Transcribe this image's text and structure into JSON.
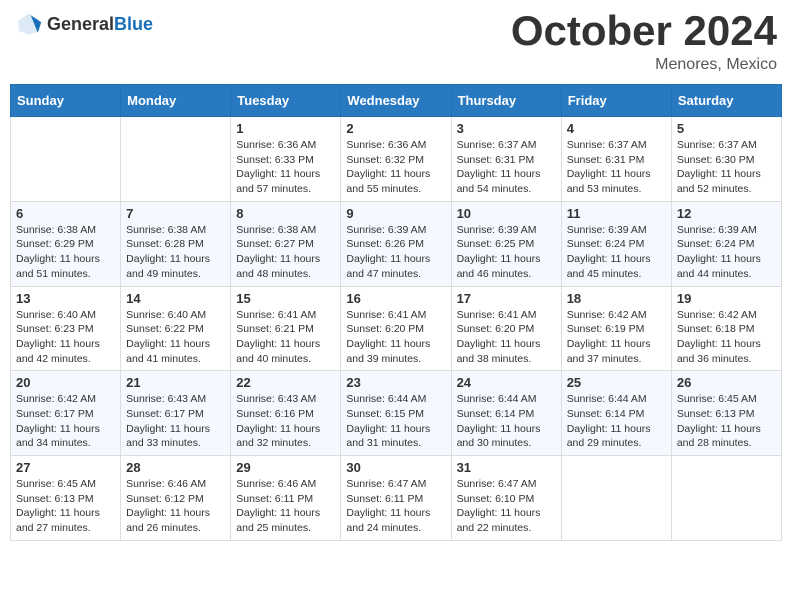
{
  "logo": {
    "general": "General",
    "blue": "Blue"
  },
  "header": {
    "month": "October 2024",
    "location": "Menores, Mexico"
  },
  "weekdays": [
    "Sunday",
    "Monday",
    "Tuesday",
    "Wednesday",
    "Thursday",
    "Friday",
    "Saturday"
  ],
  "weeks": [
    [
      {
        "day": "",
        "sunrise": "",
        "sunset": "",
        "daylight": ""
      },
      {
        "day": "",
        "sunrise": "",
        "sunset": "",
        "daylight": ""
      },
      {
        "day": "1",
        "sunrise": "Sunrise: 6:36 AM",
        "sunset": "Sunset: 6:33 PM",
        "daylight": "Daylight: 11 hours and 57 minutes."
      },
      {
        "day": "2",
        "sunrise": "Sunrise: 6:36 AM",
        "sunset": "Sunset: 6:32 PM",
        "daylight": "Daylight: 11 hours and 55 minutes."
      },
      {
        "day": "3",
        "sunrise": "Sunrise: 6:37 AM",
        "sunset": "Sunset: 6:31 PM",
        "daylight": "Daylight: 11 hours and 54 minutes."
      },
      {
        "day": "4",
        "sunrise": "Sunrise: 6:37 AM",
        "sunset": "Sunset: 6:31 PM",
        "daylight": "Daylight: 11 hours and 53 minutes."
      },
      {
        "day": "5",
        "sunrise": "Sunrise: 6:37 AM",
        "sunset": "Sunset: 6:30 PM",
        "daylight": "Daylight: 11 hours and 52 minutes."
      }
    ],
    [
      {
        "day": "6",
        "sunrise": "Sunrise: 6:38 AM",
        "sunset": "Sunset: 6:29 PM",
        "daylight": "Daylight: 11 hours and 51 minutes."
      },
      {
        "day": "7",
        "sunrise": "Sunrise: 6:38 AM",
        "sunset": "Sunset: 6:28 PM",
        "daylight": "Daylight: 11 hours and 49 minutes."
      },
      {
        "day": "8",
        "sunrise": "Sunrise: 6:38 AM",
        "sunset": "Sunset: 6:27 PM",
        "daylight": "Daylight: 11 hours and 48 minutes."
      },
      {
        "day": "9",
        "sunrise": "Sunrise: 6:39 AM",
        "sunset": "Sunset: 6:26 PM",
        "daylight": "Daylight: 11 hours and 47 minutes."
      },
      {
        "day": "10",
        "sunrise": "Sunrise: 6:39 AM",
        "sunset": "Sunset: 6:25 PM",
        "daylight": "Daylight: 11 hours and 46 minutes."
      },
      {
        "day": "11",
        "sunrise": "Sunrise: 6:39 AM",
        "sunset": "Sunset: 6:24 PM",
        "daylight": "Daylight: 11 hours and 45 minutes."
      },
      {
        "day": "12",
        "sunrise": "Sunrise: 6:39 AM",
        "sunset": "Sunset: 6:24 PM",
        "daylight": "Daylight: 11 hours and 44 minutes."
      }
    ],
    [
      {
        "day": "13",
        "sunrise": "Sunrise: 6:40 AM",
        "sunset": "Sunset: 6:23 PM",
        "daylight": "Daylight: 11 hours and 42 minutes."
      },
      {
        "day": "14",
        "sunrise": "Sunrise: 6:40 AM",
        "sunset": "Sunset: 6:22 PM",
        "daylight": "Daylight: 11 hours and 41 minutes."
      },
      {
        "day": "15",
        "sunrise": "Sunrise: 6:41 AM",
        "sunset": "Sunset: 6:21 PM",
        "daylight": "Daylight: 11 hours and 40 minutes."
      },
      {
        "day": "16",
        "sunrise": "Sunrise: 6:41 AM",
        "sunset": "Sunset: 6:20 PM",
        "daylight": "Daylight: 11 hours and 39 minutes."
      },
      {
        "day": "17",
        "sunrise": "Sunrise: 6:41 AM",
        "sunset": "Sunset: 6:20 PM",
        "daylight": "Daylight: 11 hours and 38 minutes."
      },
      {
        "day": "18",
        "sunrise": "Sunrise: 6:42 AM",
        "sunset": "Sunset: 6:19 PM",
        "daylight": "Daylight: 11 hours and 37 minutes."
      },
      {
        "day": "19",
        "sunrise": "Sunrise: 6:42 AM",
        "sunset": "Sunset: 6:18 PM",
        "daylight": "Daylight: 11 hours and 36 minutes."
      }
    ],
    [
      {
        "day": "20",
        "sunrise": "Sunrise: 6:42 AM",
        "sunset": "Sunset: 6:17 PM",
        "daylight": "Daylight: 11 hours and 34 minutes."
      },
      {
        "day": "21",
        "sunrise": "Sunrise: 6:43 AM",
        "sunset": "Sunset: 6:17 PM",
        "daylight": "Daylight: 11 hours and 33 minutes."
      },
      {
        "day": "22",
        "sunrise": "Sunrise: 6:43 AM",
        "sunset": "Sunset: 6:16 PM",
        "daylight": "Daylight: 11 hours and 32 minutes."
      },
      {
        "day": "23",
        "sunrise": "Sunrise: 6:44 AM",
        "sunset": "Sunset: 6:15 PM",
        "daylight": "Daylight: 11 hours and 31 minutes."
      },
      {
        "day": "24",
        "sunrise": "Sunrise: 6:44 AM",
        "sunset": "Sunset: 6:14 PM",
        "daylight": "Daylight: 11 hours and 30 minutes."
      },
      {
        "day": "25",
        "sunrise": "Sunrise: 6:44 AM",
        "sunset": "Sunset: 6:14 PM",
        "daylight": "Daylight: 11 hours and 29 minutes."
      },
      {
        "day": "26",
        "sunrise": "Sunrise: 6:45 AM",
        "sunset": "Sunset: 6:13 PM",
        "daylight": "Daylight: 11 hours and 28 minutes."
      }
    ],
    [
      {
        "day": "27",
        "sunrise": "Sunrise: 6:45 AM",
        "sunset": "Sunset: 6:13 PM",
        "daylight": "Daylight: 11 hours and 27 minutes."
      },
      {
        "day": "28",
        "sunrise": "Sunrise: 6:46 AM",
        "sunset": "Sunset: 6:12 PM",
        "daylight": "Daylight: 11 hours and 26 minutes."
      },
      {
        "day": "29",
        "sunrise": "Sunrise: 6:46 AM",
        "sunset": "Sunset: 6:11 PM",
        "daylight": "Daylight: 11 hours and 25 minutes."
      },
      {
        "day": "30",
        "sunrise": "Sunrise: 6:47 AM",
        "sunset": "Sunset: 6:11 PM",
        "daylight": "Daylight: 11 hours and 24 minutes."
      },
      {
        "day": "31",
        "sunrise": "Sunrise: 6:47 AM",
        "sunset": "Sunset: 6:10 PM",
        "daylight": "Daylight: 11 hours and 22 minutes."
      },
      {
        "day": "",
        "sunrise": "",
        "sunset": "",
        "daylight": ""
      },
      {
        "day": "",
        "sunrise": "",
        "sunset": "",
        "daylight": ""
      }
    ]
  ]
}
